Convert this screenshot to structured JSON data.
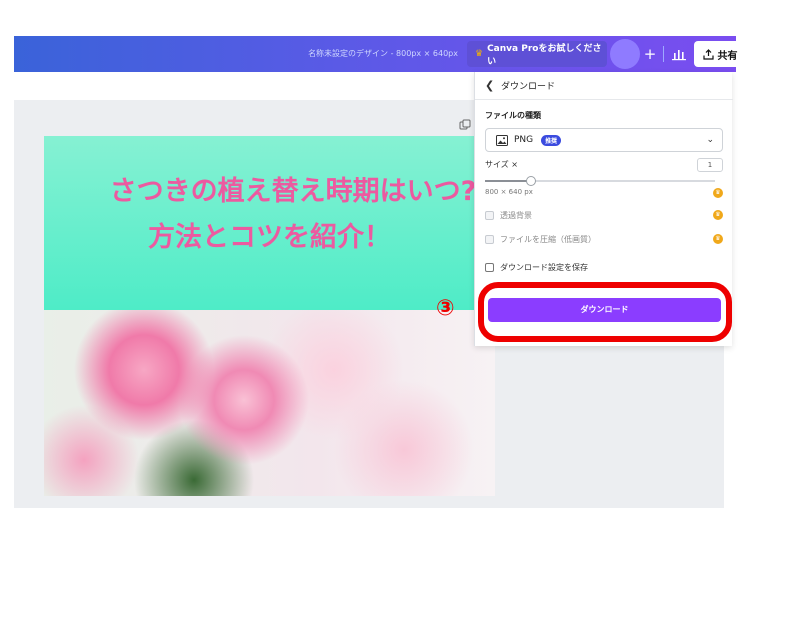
{
  "header": {
    "title": "名称未設定のデザイン - 800px × 640px",
    "pro_button_label": "Canva Proをお試しください",
    "plus_label": "+",
    "share_label": "共有"
  },
  "design": {
    "headline_line1": "さつきの植え替え時期はいつ?",
    "headline_line2": "方法とコツを紹介！"
  },
  "download_panel": {
    "title": "ダウンロード",
    "file_type_label": "ファイルの種類",
    "file_type_value": "PNG",
    "file_type_badge": "推奨",
    "size_label": "サイズ ×",
    "size_value": "1",
    "size_slider_fraction": 0.2,
    "dimensions": "800 × 640 px",
    "options": [
      {
        "label": "透過背景",
        "checked": false,
        "pro": true
      },
      {
        "label": "ファイルを圧縮（低画質）",
        "checked": false,
        "pro": true
      },
      {
        "label": "ダウンロード設定を保存",
        "checked": false,
        "pro": false
      }
    ],
    "download_button_label": "ダウンロード"
  },
  "annotation": {
    "step_label": "③"
  },
  "colors": {
    "accent": "#8b3dff",
    "headline": "#ec5aa0",
    "banner": "#4eecc7",
    "highlight": "#ee0000",
    "pro": "#f0a81a"
  }
}
